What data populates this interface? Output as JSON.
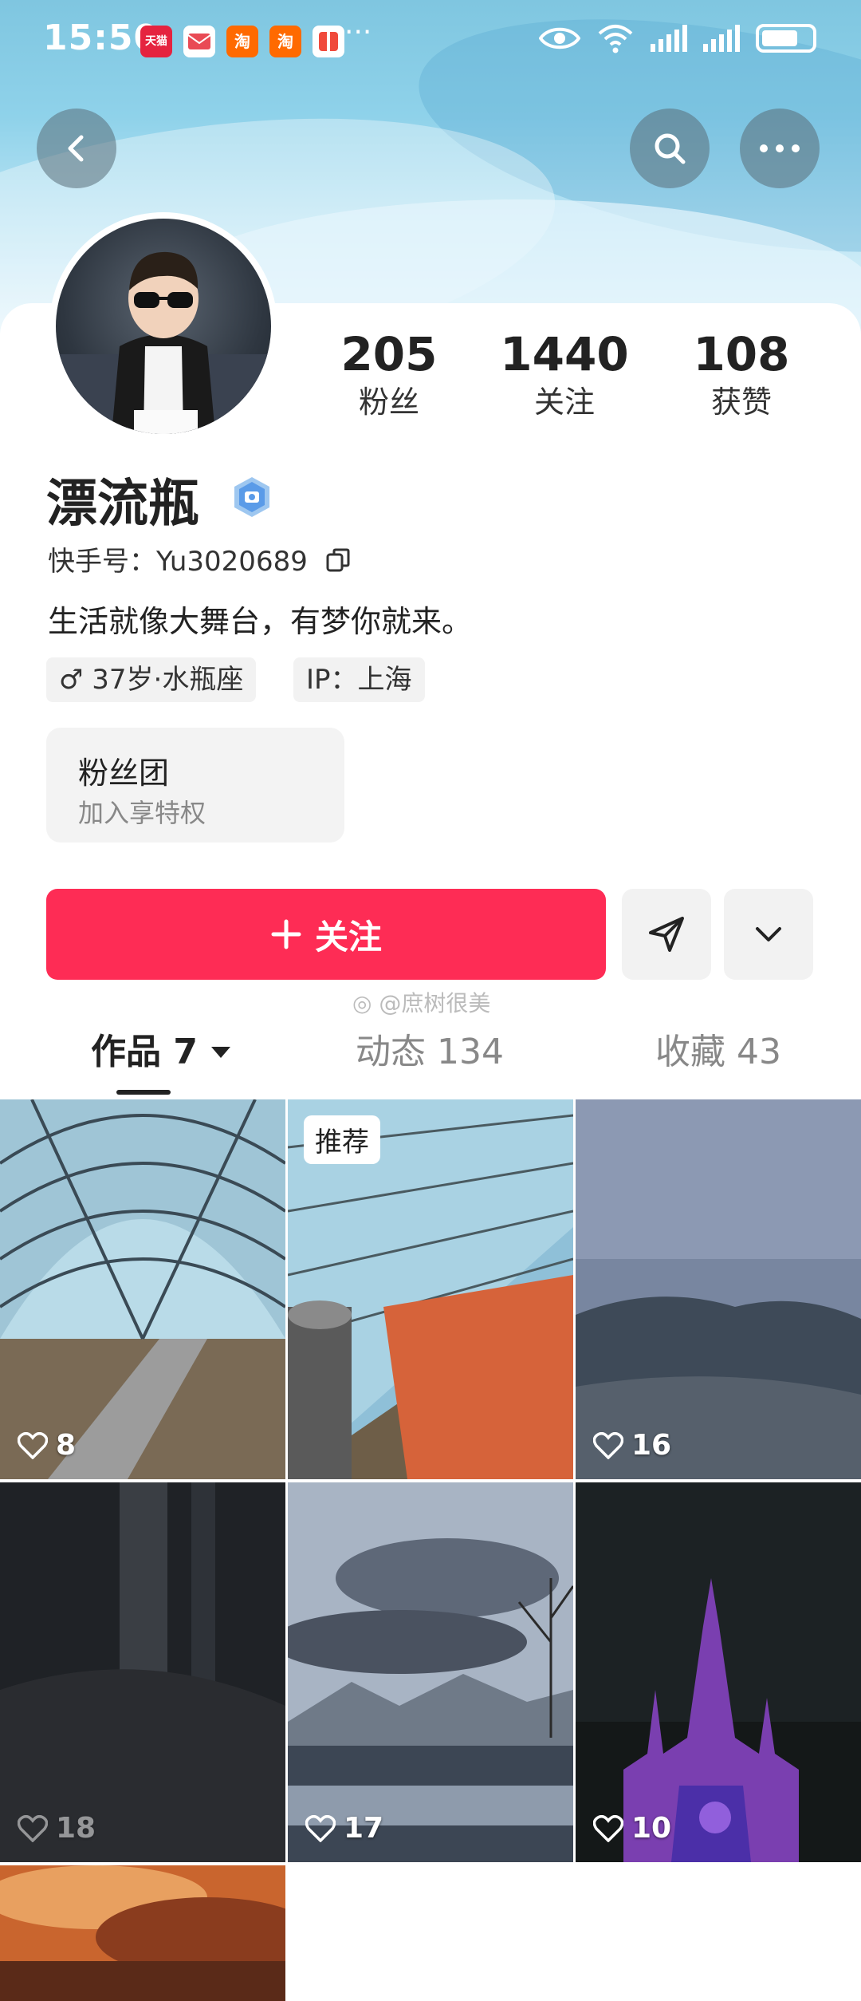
{
  "status_bar": {
    "time": "15:50",
    "app_icons": [
      {
        "name": "tmall-icon",
        "label": "天猫",
        "color": "#e5233f"
      },
      {
        "name": "mail-icon",
        "label": "",
        "color": "#e94a55"
      },
      {
        "name": "taobao-icon",
        "label": "淘",
        "color": "#ff6a00"
      },
      {
        "name": "taobao-icon-2",
        "label": "淘",
        "color": "#ff6a00"
      },
      {
        "name": "gift-icon",
        "label": "",
        "color": "#f04a3c"
      }
    ],
    "more": "···"
  },
  "profile": {
    "stats": [
      {
        "value": "205",
        "label": "粉丝"
      },
      {
        "value": "1440",
        "label": "关注"
      },
      {
        "value": "108",
        "label": "获赞"
      }
    ],
    "name": "漂流瓶",
    "kuaishou_id": "快手号：Yu3020689",
    "bio": "生活就像大舞台，有梦你就来。",
    "tags": [
      "♂ 37岁·水瓶座",
      "IP：上海"
    ],
    "fan_club": {
      "title": "粉丝团",
      "subtitle": "加入享特权"
    }
  },
  "actions": {
    "follow_label": "关注",
    "accent": "#fe2c55"
  },
  "watermark": "@庶树很美",
  "tabs": [
    {
      "label": "作品 7",
      "active": true
    },
    {
      "label": "动态 134",
      "active": false
    },
    {
      "label": "收藏 43",
      "active": false
    }
  ],
  "works": [
    {
      "likes": "8",
      "tag": ""
    },
    {
      "likes": "",
      "tag": "推荐"
    },
    {
      "likes": "16",
      "tag": ""
    },
    {
      "likes": "18",
      "tag": ""
    },
    {
      "likes": "17",
      "tag": ""
    },
    {
      "likes": "10",
      "tag": ""
    },
    {
      "likes": "",
      "tag": ""
    }
  ]
}
